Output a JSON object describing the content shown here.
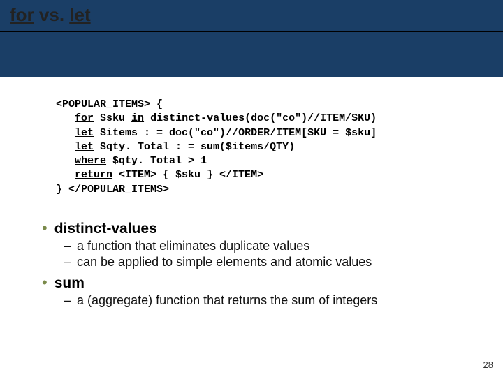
{
  "title": {
    "kw1": "for",
    "mid": " vs. ",
    "kw2": "let"
  },
  "code": {
    "l1a": "<POPULAR_ITEMS> {",
    "l2_kw1": "for",
    "l2_mid1": " $sku ",
    "l2_kw2": "in",
    "l2_rest": " distinct-values(doc(\"co\")//ITEM/SKU)",
    "l3_kw": "let",
    "l3_rest": " $items : = doc(\"co\")//ORDER/ITEM[SKU = $sku]",
    "l4_kw": "let",
    "l4_rest": " $qty. Total : = sum($items/QTY)",
    "l5_kw": "where",
    "l5_rest": " $qty. Total > 1",
    "l6_kw": "return",
    "l6_rest": " <ITEM> { $sku } </ITEM>",
    "l7": "} </POPULAR_ITEMS>"
  },
  "bullets": {
    "b1": {
      "label": "distinct-values",
      "subs": [
        "a function that eliminates duplicate values",
        "can be applied to simple elements and atomic values"
      ]
    },
    "b2": {
      "label": "sum",
      "subs": [
        "a (aggregate) function that returns the sum of integers"
      ]
    }
  },
  "pageNumber": "28"
}
